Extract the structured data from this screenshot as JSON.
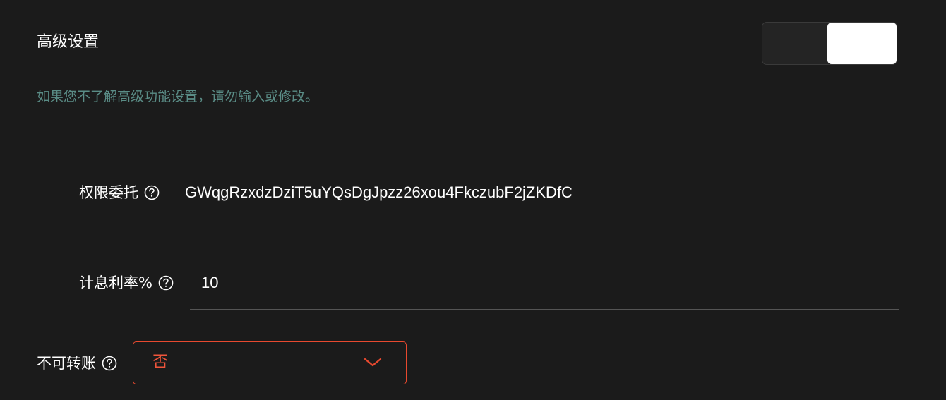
{
  "header": {
    "title": "高级设置",
    "toggle_on": true
  },
  "hint": "如果您不了解高级功能设置，请勿输入或修改。",
  "fields": {
    "delegation": {
      "label": "权限委托",
      "value": "GWqgRzxdzDziT5uYQsDgJpzz26xou4FkczubF2jZKDfC"
    },
    "interest_rate": {
      "label": "计息利率%",
      "value": "10"
    },
    "non_transferable": {
      "label": "不可转账",
      "selected": "否"
    }
  },
  "colors": {
    "background": "#1b1b1b",
    "hint": "#5a8c86",
    "accent": "#e8492f"
  },
  "icons": {
    "help": "question-circle-icon",
    "dropdown": "chevron-down-icon"
  }
}
